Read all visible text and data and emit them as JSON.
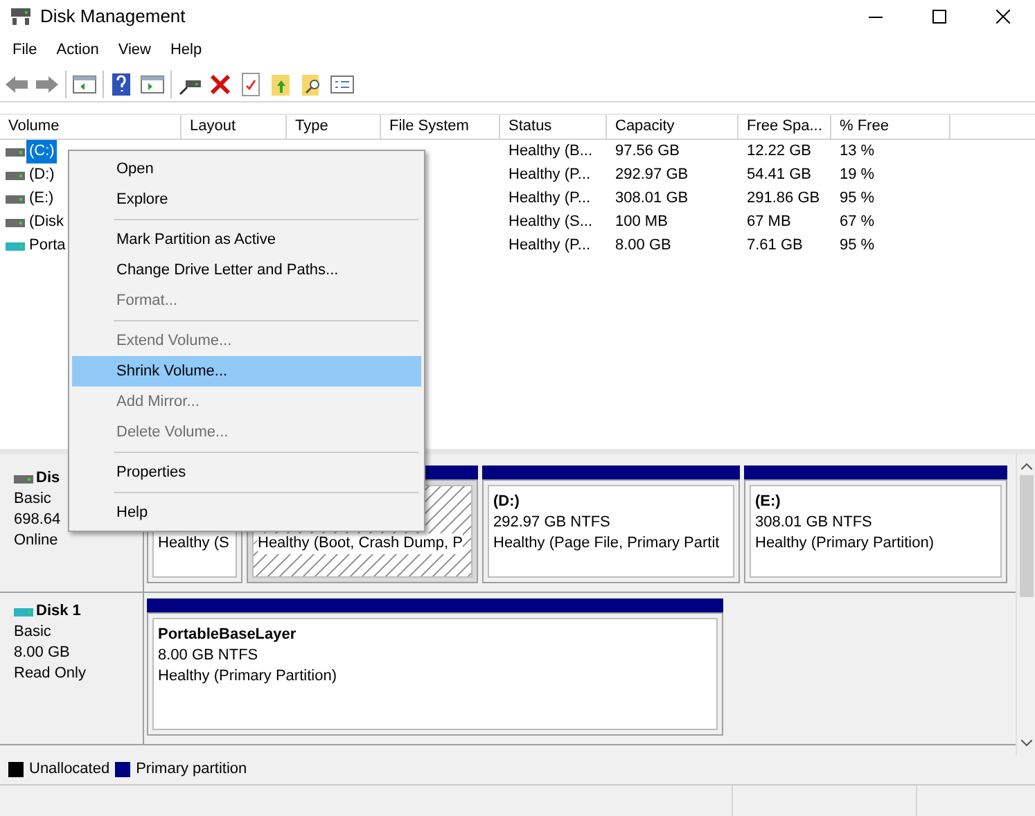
{
  "window": {
    "title": "Disk Management"
  },
  "menu_bar": [
    "File",
    "Action",
    "View",
    "Help"
  ],
  "volume_table": {
    "columns": [
      "Volume",
      "Layout",
      "Type",
      "File System",
      "Status",
      "Capacity",
      "Free Spa...",
      "% Free"
    ],
    "rows": [
      {
        "volume": "(C:)",
        "selected": true,
        "kind": "hdd",
        "status": "Healthy (B...",
        "capacity": "97.56 GB",
        "free_space": "12.22 GB",
        "percent_free": "13 %"
      },
      {
        "volume": "(D:)",
        "selected": false,
        "kind": "hdd",
        "status": "Healthy (P...",
        "capacity": "292.97 GB",
        "free_space": "54.41 GB",
        "percent_free": "19 %"
      },
      {
        "volume": "(E:)",
        "selected": false,
        "kind": "hdd",
        "status": "Healthy (P...",
        "capacity": "308.01 GB",
        "free_space": "291.86 GB",
        "percent_free": "95 %"
      },
      {
        "volume": "(Disk",
        "selected": false,
        "kind": "hdd",
        "status": "Healthy (S...",
        "capacity": "100 MB",
        "free_space": "67 MB",
        "percent_free": "67 %"
      },
      {
        "volume": "Porta",
        "selected": false,
        "kind": "removable",
        "status": "Healthy (P...",
        "capacity": "8.00 GB",
        "free_space": "7.61 GB",
        "percent_free": "95 %"
      }
    ]
  },
  "context_menu": {
    "items": [
      {
        "kind": "item",
        "label": "Open",
        "disabled": false,
        "selected": false
      },
      {
        "kind": "item",
        "label": "Explore",
        "disabled": false,
        "selected": false
      },
      {
        "kind": "separator"
      },
      {
        "kind": "item",
        "label": "Mark Partition as Active",
        "disabled": false,
        "selected": false
      },
      {
        "kind": "item",
        "label": "Change Drive Letter and Paths...",
        "disabled": false,
        "selected": false
      },
      {
        "kind": "item",
        "label": "Format...",
        "disabled": true,
        "selected": false
      },
      {
        "kind": "separator"
      },
      {
        "kind": "item",
        "label": "Extend Volume...",
        "disabled": true,
        "selected": false
      },
      {
        "kind": "item",
        "label": "Shrink Volume...",
        "disabled": false,
        "selected": true
      },
      {
        "kind": "item",
        "label": "Add Mirror...",
        "disabled": true,
        "selected": false
      },
      {
        "kind": "item",
        "label": "Delete Volume...",
        "disabled": true,
        "selected": false
      },
      {
        "kind": "separator"
      },
      {
        "kind": "item",
        "label": "Properties",
        "disabled": false,
        "selected": false
      },
      {
        "kind": "separator"
      },
      {
        "kind": "item",
        "label": "Help",
        "disabled": false,
        "selected": false
      }
    ]
  },
  "disks": [
    {
      "name": "Dis",
      "kind": "hdd",
      "type": "Basic",
      "size": "698.64",
      "state": "Online",
      "partitions": [
        {
          "status": "Healthy (S",
          "selected": false
        },
        {
          "status": "Healthy (Boot, Crash Dump, P",
          "selected": true
        },
        {
          "name": "(D:)",
          "size": "292.97 GB NTFS",
          "status": "Healthy (Page File, Primary Partit",
          "selected": false
        },
        {
          "name": "(E:)",
          "size": "308.01 GB NTFS",
          "status": "Healthy (Primary Partition)",
          "selected": false
        }
      ]
    },
    {
      "name": "Disk 1",
      "kind": "removable",
      "type": "Basic",
      "size": "8.00 GB",
      "state": "Read Only",
      "partitions": [
        {
          "name": "PortableBaseLayer",
          "size": "8.00 GB NTFS",
          "status": "Healthy (Primary Partition)",
          "selected": false
        }
      ]
    }
  ],
  "legend": [
    {
      "label": "Unallocated",
      "color": "#000000"
    },
    {
      "label": "Primary partition",
      "color": "#000080"
    }
  ]
}
